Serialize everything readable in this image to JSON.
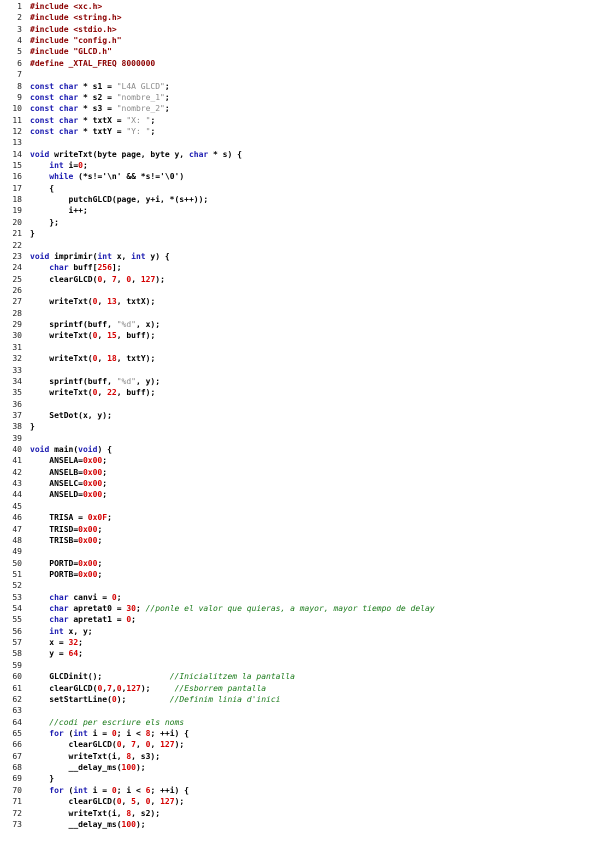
{
  "lines": [
    {
      "n": "1",
      "t": [
        {
          "c": "pp",
          "s": "#include <xc.h>"
        }
      ]
    },
    {
      "n": "2",
      "t": [
        {
          "c": "pp",
          "s": "#include <string.h>"
        }
      ]
    },
    {
      "n": "3",
      "t": [
        {
          "c": "pp",
          "s": "#include <stdio.h>"
        }
      ]
    },
    {
      "n": "4",
      "t": [
        {
          "c": "pp",
          "s": "#include \"config.h\""
        }
      ]
    },
    {
      "n": "5",
      "t": [
        {
          "c": "pp",
          "s": "#include \"GLCD.h\""
        }
      ]
    },
    {
      "n": "6",
      "t": [
        {
          "c": "pp",
          "s": "#define _XTAL_FREQ 8000000"
        }
      ]
    },
    {
      "n": "7",
      "t": []
    },
    {
      "n": "8",
      "t": [
        {
          "c": "kw",
          "s": "const char"
        },
        {
          "c": "",
          "s": " * s1 = "
        },
        {
          "c": "str",
          "s": "\"L4A GLCD\""
        },
        {
          "c": "",
          "s": ";"
        }
      ]
    },
    {
      "n": "9",
      "t": [
        {
          "c": "kw",
          "s": "const char"
        },
        {
          "c": "",
          "s": " * s2 = "
        },
        {
          "c": "str",
          "s": "\"nombre_1\""
        },
        {
          "c": "",
          "s": ";"
        }
      ]
    },
    {
      "n": "10",
      "t": [
        {
          "c": "kw",
          "s": "const char"
        },
        {
          "c": "",
          "s": " * s3 = "
        },
        {
          "c": "str",
          "s": "\"nombre_2\""
        },
        {
          "c": "",
          "s": ";"
        }
      ]
    },
    {
      "n": "11",
      "t": [
        {
          "c": "kw",
          "s": "const char"
        },
        {
          "c": "",
          "s": " * txtX = "
        },
        {
          "c": "str",
          "s": "\"X: \""
        },
        {
          "c": "",
          "s": ";"
        }
      ]
    },
    {
      "n": "12",
      "t": [
        {
          "c": "kw",
          "s": "const char"
        },
        {
          "c": "",
          "s": " * txtY = "
        },
        {
          "c": "str",
          "s": "\"Y: \""
        },
        {
          "c": "",
          "s": ";"
        }
      ]
    },
    {
      "n": "13",
      "t": []
    },
    {
      "n": "14",
      "t": [
        {
          "c": "kw",
          "s": "void"
        },
        {
          "c": "",
          "s": " writeTxt(byte page, byte y, "
        },
        {
          "c": "kw",
          "s": "char"
        },
        {
          "c": "",
          "s": " * s) {"
        }
      ]
    },
    {
      "n": "15",
      "t": [
        {
          "c": "",
          "s": "    "
        },
        {
          "c": "kw",
          "s": "int"
        },
        {
          "c": "",
          "s": " i="
        },
        {
          "c": "num",
          "s": "0"
        },
        {
          "c": "",
          "s": ";"
        }
      ]
    },
    {
      "n": "16",
      "t": [
        {
          "c": "",
          "s": "    "
        },
        {
          "c": "kw",
          "s": "while"
        },
        {
          "c": "",
          "s": " (*s!='\\n' && *s!='\\0')"
        }
      ]
    },
    {
      "n": "17",
      "t": [
        {
          "c": "",
          "s": "    {"
        }
      ]
    },
    {
      "n": "18",
      "t": [
        {
          "c": "",
          "s": "        putchGLCD(page, y+i, *(s++));"
        }
      ]
    },
    {
      "n": "19",
      "t": [
        {
          "c": "",
          "s": "        i++;"
        }
      ]
    },
    {
      "n": "20",
      "t": [
        {
          "c": "",
          "s": "    };"
        }
      ]
    },
    {
      "n": "21",
      "t": [
        {
          "c": "",
          "s": "}"
        }
      ]
    },
    {
      "n": "22",
      "t": []
    },
    {
      "n": "23",
      "t": [
        {
          "c": "kw",
          "s": "void"
        },
        {
          "c": "",
          "s": " imprimir("
        },
        {
          "c": "kw",
          "s": "int"
        },
        {
          "c": "",
          "s": " x, "
        },
        {
          "c": "kw",
          "s": "int"
        },
        {
          "c": "",
          "s": " y) {"
        }
      ]
    },
    {
      "n": "24",
      "t": [
        {
          "c": "",
          "s": "    "
        },
        {
          "c": "kw",
          "s": "char"
        },
        {
          "c": "",
          "s": " buff["
        },
        {
          "c": "num",
          "s": "256"
        },
        {
          "c": "",
          "s": "];"
        }
      ]
    },
    {
      "n": "25",
      "t": [
        {
          "c": "",
          "s": "    clearGLCD("
        },
        {
          "c": "num",
          "s": "0"
        },
        {
          "c": "",
          "s": ", "
        },
        {
          "c": "num",
          "s": "7"
        },
        {
          "c": "",
          "s": ", "
        },
        {
          "c": "num",
          "s": "0"
        },
        {
          "c": "",
          "s": ", "
        },
        {
          "c": "num",
          "s": "127"
        },
        {
          "c": "",
          "s": ");"
        }
      ]
    },
    {
      "n": "26",
      "t": []
    },
    {
      "n": "27",
      "t": [
        {
          "c": "",
          "s": "    writeTxt("
        },
        {
          "c": "num",
          "s": "0"
        },
        {
          "c": "",
          "s": ", "
        },
        {
          "c": "num",
          "s": "13"
        },
        {
          "c": "",
          "s": ", txtX);"
        }
      ]
    },
    {
      "n": "28",
      "t": []
    },
    {
      "n": "29",
      "t": [
        {
          "c": "",
          "s": "    sprintf(buff, "
        },
        {
          "c": "str",
          "s": "\"%d\""
        },
        {
          "c": "",
          "s": ", x);"
        }
      ]
    },
    {
      "n": "30",
      "t": [
        {
          "c": "",
          "s": "    writeTxt("
        },
        {
          "c": "num",
          "s": "0"
        },
        {
          "c": "",
          "s": ", "
        },
        {
          "c": "num",
          "s": "15"
        },
        {
          "c": "",
          "s": ", buff);"
        }
      ]
    },
    {
      "n": "31",
      "t": []
    },
    {
      "n": "32",
      "t": [
        {
          "c": "",
          "s": "    writeTxt("
        },
        {
          "c": "num",
          "s": "0"
        },
        {
          "c": "",
          "s": ", "
        },
        {
          "c": "num",
          "s": "18"
        },
        {
          "c": "",
          "s": ", txtY);"
        }
      ]
    },
    {
      "n": "33",
      "t": []
    },
    {
      "n": "34",
      "t": [
        {
          "c": "",
          "s": "    sprintf(buff, "
        },
        {
          "c": "str",
          "s": "\"%d\""
        },
        {
          "c": "",
          "s": ", y);"
        }
      ]
    },
    {
      "n": "35",
      "t": [
        {
          "c": "",
          "s": "    writeTxt("
        },
        {
          "c": "num",
          "s": "0"
        },
        {
          "c": "",
          "s": ", "
        },
        {
          "c": "num",
          "s": "22"
        },
        {
          "c": "",
          "s": ", buff);"
        }
      ]
    },
    {
      "n": "36",
      "t": []
    },
    {
      "n": "37",
      "t": [
        {
          "c": "",
          "s": "    SetDot(x, y);"
        }
      ]
    },
    {
      "n": "38",
      "t": [
        {
          "c": "",
          "s": "}"
        }
      ]
    },
    {
      "n": "39",
      "t": []
    },
    {
      "n": "40",
      "t": [
        {
          "c": "kw",
          "s": "void"
        },
        {
          "c": "",
          "s": " main("
        },
        {
          "c": "kw",
          "s": "void"
        },
        {
          "c": "",
          "s": ") {"
        }
      ]
    },
    {
      "n": "41",
      "t": [
        {
          "c": "",
          "s": "    ANSELA="
        },
        {
          "c": "num",
          "s": "0x00"
        },
        {
          "c": "",
          "s": ";"
        }
      ]
    },
    {
      "n": "42",
      "t": [
        {
          "c": "",
          "s": "    ANSELB="
        },
        {
          "c": "num",
          "s": "0x00"
        },
        {
          "c": "",
          "s": ";"
        }
      ]
    },
    {
      "n": "43",
      "t": [
        {
          "c": "",
          "s": "    ANSELC="
        },
        {
          "c": "num",
          "s": "0x00"
        },
        {
          "c": "",
          "s": ";"
        }
      ]
    },
    {
      "n": "44",
      "t": [
        {
          "c": "",
          "s": "    ANSELD="
        },
        {
          "c": "num",
          "s": "0x00"
        },
        {
          "c": "",
          "s": ";"
        }
      ]
    },
    {
      "n": "45",
      "t": []
    },
    {
      "n": "46",
      "t": [
        {
          "c": "",
          "s": "    TRISA = "
        },
        {
          "c": "num",
          "s": "0x0F"
        },
        {
          "c": "",
          "s": ";"
        }
      ]
    },
    {
      "n": "47",
      "t": [
        {
          "c": "",
          "s": "    TRISD="
        },
        {
          "c": "num",
          "s": "0x00"
        },
        {
          "c": "",
          "s": ";"
        }
      ]
    },
    {
      "n": "48",
      "t": [
        {
          "c": "",
          "s": "    TRISB="
        },
        {
          "c": "num",
          "s": "0x00"
        },
        {
          "c": "",
          "s": ";"
        }
      ]
    },
    {
      "n": "49",
      "t": []
    },
    {
      "n": "50",
      "t": [
        {
          "c": "",
          "s": "    PORTD="
        },
        {
          "c": "num",
          "s": "0x00"
        },
        {
          "c": "",
          "s": ";"
        }
      ]
    },
    {
      "n": "51",
      "t": [
        {
          "c": "",
          "s": "    PORTB="
        },
        {
          "c": "num",
          "s": "0x00"
        },
        {
          "c": "",
          "s": ";"
        }
      ]
    },
    {
      "n": "52",
      "t": []
    },
    {
      "n": "53",
      "t": [
        {
          "c": "",
          "s": "    "
        },
        {
          "c": "kw",
          "s": "char"
        },
        {
          "c": "",
          "s": " canvi = "
        },
        {
          "c": "num",
          "s": "0"
        },
        {
          "c": "",
          "s": ";"
        }
      ]
    },
    {
      "n": "54",
      "t": [
        {
          "c": "",
          "s": "    "
        },
        {
          "c": "kw",
          "s": "char"
        },
        {
          "c": "",
          "s": " apretat0 = "
        },
        {
          "c": "num",
          "s": "30"
        },
        {
          "c": "",
          "s": "; "
        },
        {
          "c": "cm",
          "s": "//ponle el valor que quieras, a mayor, mayor tiempo de delay"
        }
      ]
    },
    {
      "n": "55",
      "t": [
        {
          "c": "",
          "s": "    "
        },
        {
          "c": "kw",
          "s": "char"
        },
        {
          "c": "",
          "s": " apretat1 = "
        },
        {
          "c": "num",
          "s": "0"
        },
        {
          "c": "",
          "s": ";"
        }
      ]
    },
    {
      "n": "56",
      "t": [
        {
          "c": "",
          "s": "    "
        },
        {
          "c": "kw",
          "s": "int"
        },
        {
          "c": "",
          "s": " x, y;"
        }
      ]
    },
    {
      "n": "57",
      "t": [
        {
          "c": "",
          "s": "    x = "
        },
        {
          "c": "num",
          "s": "32"
        },
        {
          "c": "",
          "s": ";"
        }
      ]
    },
    {
      "n": "58",
      "t": [
        {
          "c": "",
          "s": "    y = "
        },
        {
          "c": "num",
          "s": "64"
        },
        {
          "c": "",
          "s": ";"
        }
      ]
    },
    {
      "n": "59",
      "t": []
    },
    {
      "n": "60",
      "t": [
        {
          "c": "",
          "s": "    GLCDinit();              "
        },
        {
          "c": "cm",
          "s": "//Inicialitzem la pantalla"
        }
      ]
    },
    {
      "n": "61",
      "t": [
        {
          "c": "",
          "s": "    clearGLCD("
        },
        {
          "c": "num",
          "s": "0"
        },
        {
          "c": "",
          "s": ","
        },
        {
          "c": "num",
          "s": "7"
        },
        {
          "c": "",
          "s": ","
        },
        {
          "c": "num",
          "s": "0"
        },
        {
          "c": "",
          "s": ","
        },
        {
          "c": "num",
          "s": "127"
        },
        {
          "c": "",
          "s": ");     "
        },
        {
          "c": "cm",
          "s": "//Esborrem pantalla"
        }
      ]
    },
    {
      "n": "62",
      "t": [
        {
          "c": "",
          "s": "    setStartLine("
        },
        {
          "c": "num",
          "s": "0"
        },
        {
          "c": "",
          "s": ");         "
        },
        {
          "c": "cm",
          "s": "//Definim linia d'inici"
        }
      ]
    },
    {
      "n": "63",
      "t": []
    },
    {
      "n": "64",
      "t": [
        {
          "c": "",
          "s": "    "
        },
        {
          "c": "cm",
          "s": "//codi per escriure els noms"
        }
      ]
    },
    {
      "n": "65",
      "t": [
        {
          "c": "",
          "s": "    "
        },
        {
          "c": "kw",
          "s": "for"
        },
        {
          "c": "",
          "s": " ("
        },
        {
          "c": "kw",
          "s": "int"
        },
        {
          "c": "",
          "s": " i = "
        },
        {
          "c": "num",
          "s": "0"
        },
        {
          "c": "",
          "s": "; i < "
        },
        {
          "c": "num",
          "s": "8"
        },
        {
          "c": "",
          "s": "; ++i) {"
        }
      ]
    },
    {
      "n": "66",
      "t": [
        {
          "c": "",
          "s": "        clearGLCD("
        },
        {
          "c": "num",
          "s": "0"
        },
        {
          "c": "",
          "s": ", "
        },
        {
          "c": "num",
          "s": "7"
        },
        {
          "c": "",
          "s": ", "
        },
        {
          "c": "num",
          "s": "0"
        },
        {
          "c": "",
          "s": ", "
        },
        {
          "c": "num",
          "s": "127"
        },
        {
          "c": "",
          "s": ");"
        }
      ]
    },
    {
      "n": "67",
      "t": [
        {
          "c": "",
          "s": "        writeTxt(i, "
        },
        {
          "c": "num",
          "s": "8"
        },
        {
          "c": "",
          "s": ", s3);"
        }
      ]
    },
    {
      "n": "68",
      "t": [
        {
          "c": "",
          "s": "        __delay_ms("
        },
        {
          "c": "num",
          "s": "100"
        },
        {
          "c": "",
          "s": ");"
        }
      ]
    },
    {
      "n": "69",
      "t": [
        {
          "c": "",
          "s": "    }"
        }
      ]
    },
    {
      "n": "70",
      "t": [
        {
          "c": "",
          "s": "    "
        },
        {
          "c": "kw",
          "s": "for"
        },
        {
          "c": "",
          "s": " ("
        },
        {
          "c": "kw",
          "s": "int"
        },
        {
          "c": "",
          "s": " i = "
        },
        {
          "c": "num",
          "s": "0"
        },
        {
          "c": "",
          "s": "; i < "
        },
        {
          "c": "num",
          "s": "6"
        },
        {
          "c": "",
          "s": "; ++i) {"
        }
      ]
    },
    {
      "n": "71",
      "t": [
        {
          "c": "",
          "s": "        clearGLCD("
        },
        {
          "c": "num",
          "s": "0"
        },
        {
          "c": "",
          "s": ", "
        },
        {
          "c": "num",
          "s": "5"
        },
        {
          "c": "",
          "s": ", "
        },
        {
          "c": "num",
          "s": "0"
        },
        {
          "c": "",
          "s": ", "
        },
        {
          "c": "num",
          "s": "127"
        },
        {
          "c": "",
          "s": ");"
        }
      ]
    },
    {
      "n": "72",
      "t": [
        {
          "c": "",
          "s": "        writeTxt(i, "
        },
        {
          "c": "num",
          "s": "8"
        },
        {
          "c": "",
          "s": ", s2);"
        }
      ]
    },
    {
      "n": "73",
      "t": [
        {
          "c": "",
          "s": "        __delay_ms("
        },
        {
          "c": "num",
          "s": "100"
        },
        {
          "c": "",
          "s": ");"
        }
      ]
    }
  ]
}
